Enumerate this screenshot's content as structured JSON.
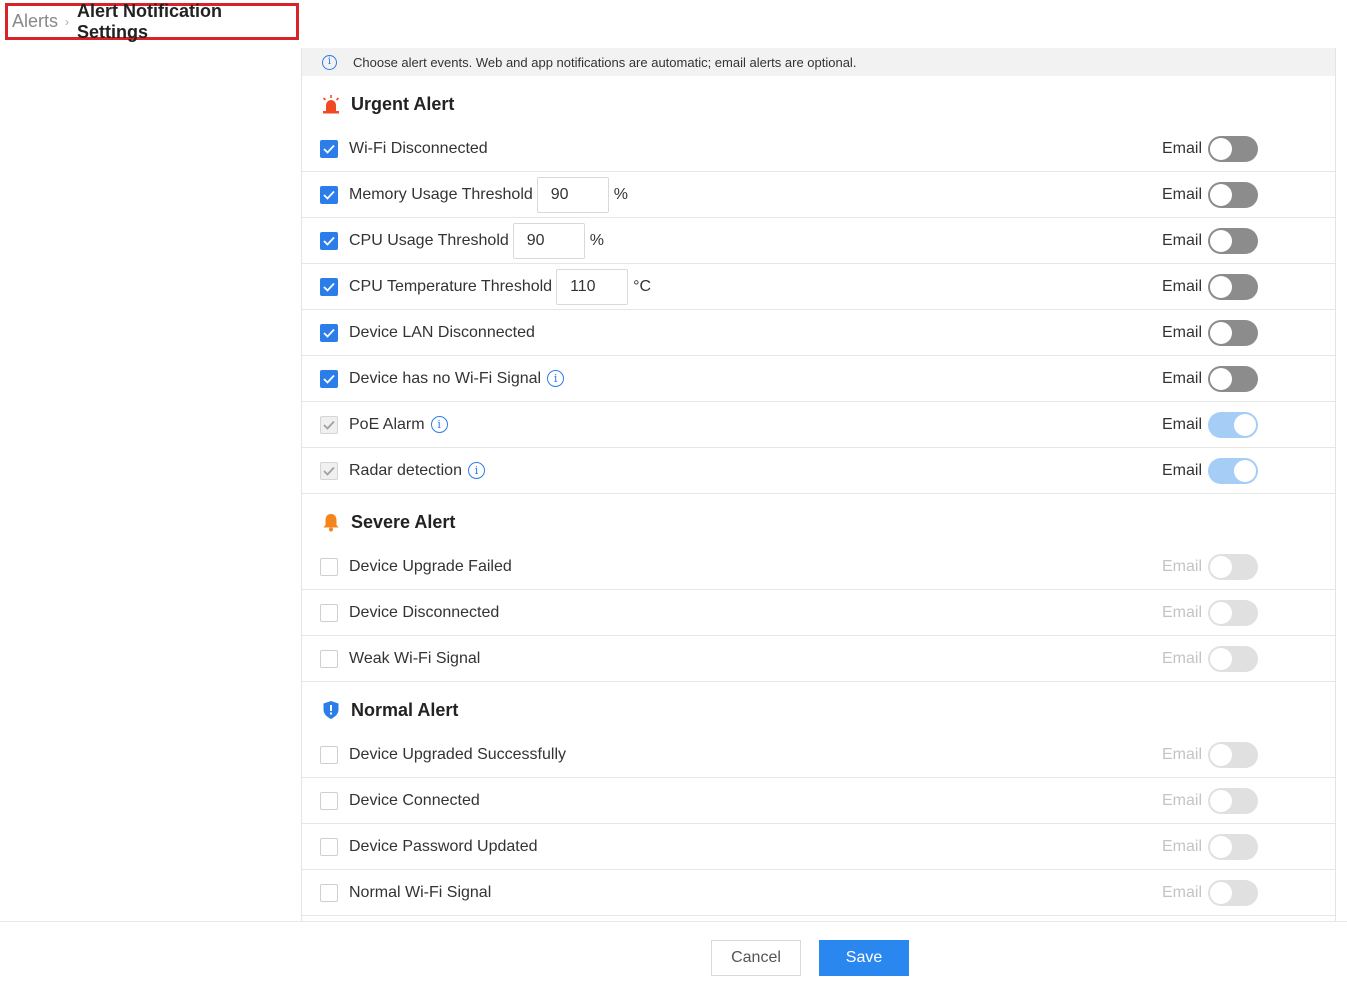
{
  "breadcrumb": {
    "parent": "Alerts",
    "separator": "›",
    "current": "Alert Notification Settings"
  },
  "info": {
    "icon": "info-icon",
    "text": "Choose alert events. Web and app notifications are automatic; email alerts are optional."
  },
  "sections": [
    {
      "title": "Urgent Alert",
      "icon": "siren-icon",
      "icon_color": "#f04a24",
      "rows": [
        {
          "label": "Wi-Fi Disconnected",
          "checked": true,
          "email_label": "Email",
          "email_on": false,
          "state": "enabled"
        },
        {
          "label": "Memory Usage Threshold",
          "checked": true,
          "value": "90",
          "unit": "%",
          "email_label": "Email",
          "email_on": false,
          "state": "enabled"
        },
        {
          "label": "CPU Usage Threshold",
          "checked": true,
          "value": "90",
          "unit": "%",
          "email_label": "Email",
          "email_on": false,
          "state": "enabled"
        },
        {
          "label": "CPU Temperature Threshold",
          "checked": true,
          "value": "110",
          "unit": "°C",
          "email_label": "Email",
          "email_on": false,
          "state": "enabled"
        },
        {
          "label": "Device LAN Disconnected",
          "checked": true,
          "email_label": "Email",
          "email_on": false,
          "state": "enabled"
        },
        {
          "label": "Device has no Wi-Fi Signal",
          "checked": true,
          "info": true,
          "email_label": "Email",
          "email_on": false,
          "state": "enabled"
        },
        {
          "label": "PoE Alarm",
          "checked": true,
          "locked": true,
          "info": true,
          "email_label": "Email",
          "email_on": true,
          "state": "enabled"
        },
        {
          "label": "Radar detection",
          "checked": true,
          "locked": true,
          "info": true,
          "email_label": "Email",
          "email_on": true,
          "state": "enabled"
        }
      ]
    },
    {
      "title": "Severe Alert",
      "icon": "bell-icon",
      "icon_color": "#f5841f",
      "rows": [
        {
          "label": "Device Upgrade Failed",
          "checked": false,
          "email_label": "Email",
          "email_on": false,
          "state": "disabled"
        },
        {
          "label": "Device Disconnected",
          "checked": false,
          "email_label": "Email",
          "email_on": false,
          "state": "disabled"
        },
        {
          "label": "Weak Wi-Fi Signal",
          "checked": false,
          "email_label": "Email",
          "email_on": false,
          "state": "disabled"
        }
      ]
    },
    {
      "title": "Normal Alert",
      "icon": "shield-icon",
      "icon_color": "#2b7de9",
      "rows": [
        {
          "label": "Device Upgraded Successfully",
          "checked": false,
          "email_label": "Email",
          "email_on": false,
          "state": "disabled"
        },
        {
          "label": "Device Connected",
          "checked": false,
          "email_label": "Email",
          "email_on": false,
          "state": "disabled"
        },
        {
          "label": "Device Password Updated",
          "checked": false,
          "email_label": "Email",
          "email_on": false,
          "state": "disabled"
        },
        {
          "label": "Normal Wi-Fi Signal",
          "checked": false,
          "email_label": "Email",
          "email_on": false,
          "state": "disabled"
        }
      ]
    }
  ],
  "footer": {
    "cancel_label": "Cancel",
    "save_label": "Save"
  },
  "colors": {
    "accent": "#2b87f0",
    "checkbox": "#2b7de9",
    "toggle_off": "#8c8c8c",
    "toggle_on_locked": "#a6cdf5",
    "highlight_border": "#d8232a"
  }
}
